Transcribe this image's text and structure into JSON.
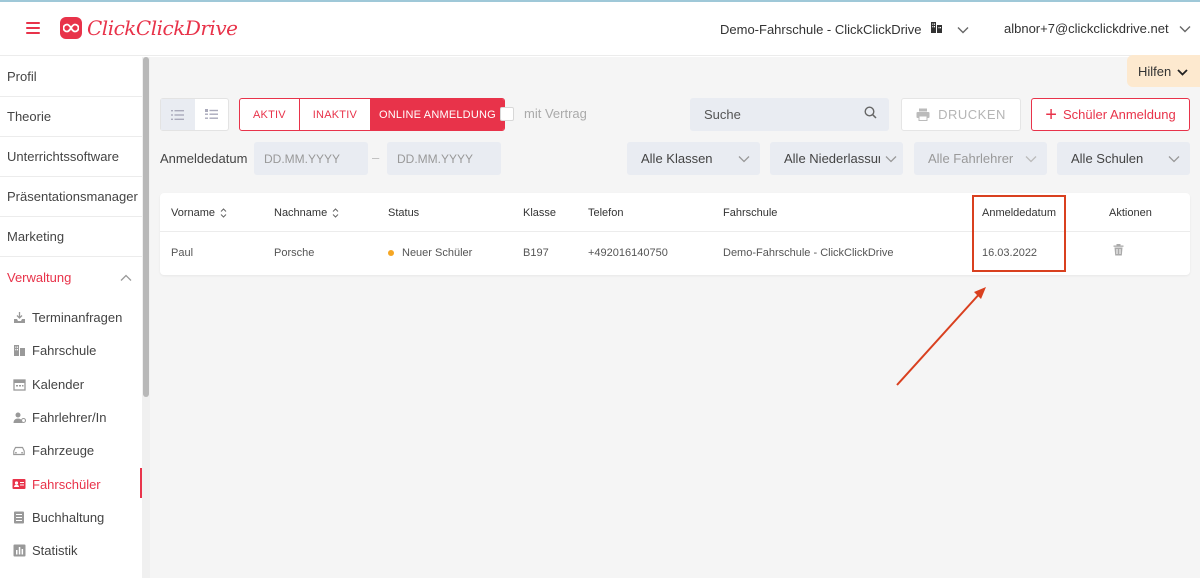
{
  "header": {
    "app_name": "ClickClickDrive",
    "school": "Demo-Fahrschule - ClickClickDrive",
    "user": "albnor+7@clickclickdrive.net",
    "hilfen": "Hilfen"
  },
  "sidebar": {
    "items": [
      {
        "label": "Profil"
      },
      {
        "label": "Theorie"
      },
      {
        "label": "Unterrichtssoftware"
      },
      {
        "label": "Präsentationsmanager"
      },
      {
        "label": "Marketing"
      },
      {
        "label": "Verwaltung"
      }
    ],
    "subitems": [
      {
        "label": "Terminanfragen",
        "icon": "inbox-icon"
      },
      {
        "label": "Fahrschule",
        "icon": "building-icon"
      },
      {
        "label": "Kalender",
        "icon": "calendar-icon"
      },
      {
        "label": "Fahrlehrer/In",
        "icon": "instructor-icon"
      },
      {
        "label": "Fahrzeuge",
        "icon": "car-icon"
      },
      {
        "label": "Fahrschüler",
        "icon": "student-card-icon"
      },
      {
        "label": "Buchhaltung",
        "icon": "ledger-icon"
      },
      {
        "label": "Statistik",
        "icon": "chart-icon"
      }
    ]
  },
  "toolbar": {
    "tabs": [
      "AKTIV",
      "INAKTIV",
      "ONLINE ANMELDUNG"
    ],
    "active_tab": "ONLINE ANMELDUNG",
    "checkbox_label": "mit Vertrag",
    "search_placeholder": "Suche",
    "print_label": "DRUCKEN",
    "add_label": "Schüler Anmeldung"
  },
  "filters": {
    "date_label": "Anmeldedatum",
    "date_from_placeholder": "DD.MM.YYYY",
    "date_to_placeholder": "DD.MM.YYYY",
    "date_separator": "–",
    "klassen": "Alle Klassen",
    "niederlassungen": "Alle Niederlassungen",
    "fahrlehrer": "Alle Fahrlehrer",
    "schulen": "Alle Schulen"
  },
  "table": {
    "headers": [
      "Vorname",
      "Nachname",
      "Status",
      "Klasse",
      "Telefon",
      "Fahrschule",
      "Anmeldedatum",
      "Aktionen"
    ],
    "rows": [
      {
        "vorname": "Paul",
        "nachname": "Porsche",
        "status": "Neuer Schüler",
        "klasse": "B197",
        "telefon": "+492016140750",
        "fahrschule": "Demo-Fahrschule - ClickClickDrive",
        "anmeldedatum": "16.03.2022"
      }
    ]
  },
  "colors": {
    "brand": "#e8334a",
    "status_new": "#f5a623",
    "annotation": "#d9401f",
    "hilfen_bg": "#fde9cf"
  }
}
